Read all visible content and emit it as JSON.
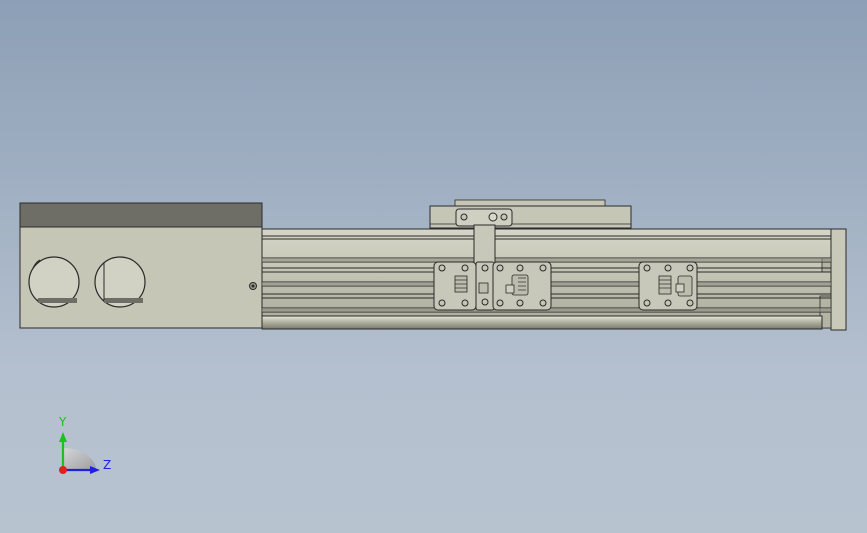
{
  "viewport": {
    "background_top": "#8d9fb6",
    "background_bottom": "#b8c3d0",
    "model": "linear-actuator-assembly",
    "part_fill": "#c4c4b4",
    "part_shade": "#9a9a8c",
    "edge_color": "#2a2a2a"
  },
  "triad": {
    "y_label": "Y",
    "z_label": "Z",
    "y_color": "#1fbf1f",
    "z_color": "#2020e0",
    "x_color": "#e02020"
  }
}
